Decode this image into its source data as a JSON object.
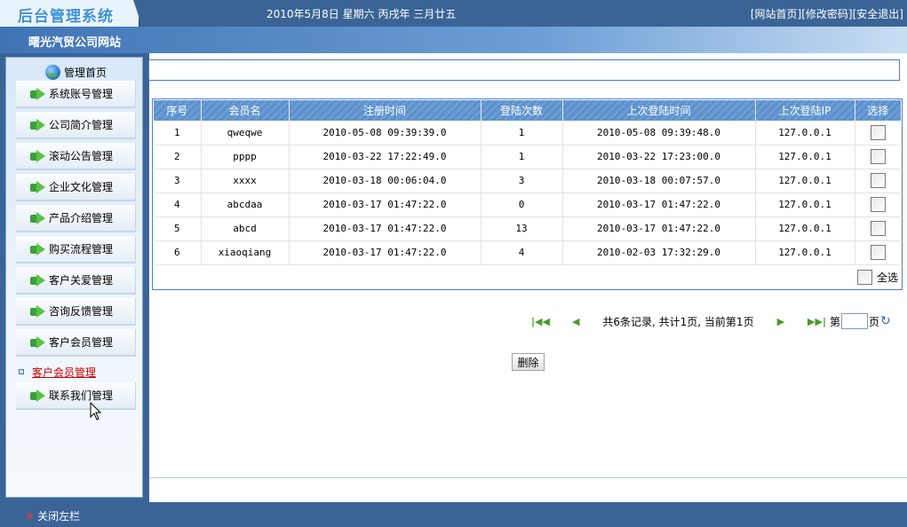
{
  "header": {
    "logo_text": "后台管理系统",
    "date_text": "2010年5月8日  星期六  丙戌年  三月廿五",
    "links": [
      "[网站首页]",
      "[修改密码]",
      "[安全退出]"
    ]
  },
  "site_name": "曙光汽贸公司网站",
  "sidebar": {
    "home_label": "管理首页",
    "items": [
      {
        "label": "系统账号管理"
      },
      {
        "label": "公司简介管理"
      },
      {
        "label": "滚动公告管理"
      },
      {
        "label": "企业文化管理"
      },
      {
        "label": "产品介绍管理"
      },
      {
        "label": "购买流程管理"
      },
      {
        "label": "客户关爱管理"
      },
      {
        "label": "咨询反馈管理"
      },
      {
        "label": "客户会员管理"
      }
    ],
    "sub_item": "客户会员管理",
    "last_item": "联系我们管理"
  },
  "table": {
    "columns": [
      "序号",
      "会员名",
      "注册时间",
      "登陆次数",
      "上次登陆时间",
      "上次登陆IP",
      "选择"
    ],
    "rows": [
      {
        "no": "1",
        "name": "qweqwe",
        "reg": "2010-05-08 09:39:39.0",
        "count": "1",
        "last": "2010-05-08 09:39:48.0",
        "ip": "127.0.0.1"
      },
      {
        "no": "2",
        "name": "pppp",
        "reg": "2010-03-22 17:22:49.0",
        "count": "1",
        "last": "2010-03-22 17:23:00.0",
        "ip": "127.0.0.1"
      },
      {
        "no": "3",
        "name": "xxxx",
        "reg": "2010-03-18 00:06:04.0",
        "count": "3",
        "last": "2010-03-18 00:07:57.0",
        "ip": "127.0.0.1"
      },
      {
        "no": "4",
        "name": "abcdaa",
        "reg": "2010-03-17 01:47:22.0",
        "count": "0",
        "last": "2010-03-17 01:47:22.0",
        "ip": "127.0.0.1"
      },
      {
        "no": "5",
        "name": "abcd",
        "reg": "2010-03-17 01:47:22.0",
        "count": "13",
        "last": "2010-03-17 01:47:22.0",
        "ip": "127.0.0.1"
      },
      {
        "no": "6",
        "name": "xiaoqiang",
        "reg": "2010-03-17 01:47:22.0",
        "count": "4",
        "last": "2010-02-03 17:32:29.0",
        "ip": "127.0.0.1"
      }
    ],
    "select_all": "全选"
  },
  "pager": {
    "info": "共6条记录, 共计1页, 当前第1页",
    "page_prefix": "第",
    "page_suffix": "页"
  },
  "delete_label": "删除",
  "footer": {
    "close_label": "关闭左栏"
  }
}
